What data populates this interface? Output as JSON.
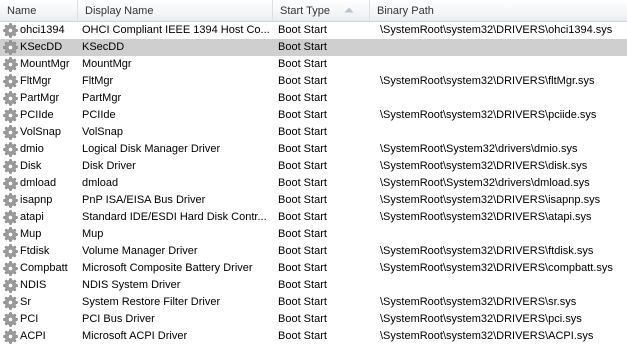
{
  "columns": {
    "name": "Name",
    "display_name": "Display Name",
    "start_type": "Start Type",
    "binary_path": "Binary Path"
  },
  "sort": {
    "column": "start_type",
    "direction": "ascending"
  },
  "icon": "gear-icon",
  "colors": {
    "selected_row": "#cfcfcf",
    "header_border": "#dcdfe3"
  },
  "rows": [
    {
      "name": "ohci1394",
      "display_name": "OHCI Compliant IEEE 1394 Host Co...",
      "start_type": "Boot Start",
      "binary_path": "\\SystemRoot\\system32\\DRIVERS\\ohci1394.sys",
      "selected": false
    },
    {
      "name": "KSecDD",
      "display_name": "KSecDD",
      "start_type": "Boot Start",
      "binary_path": "",
      "selected": true
    },
    {
      "name": "MountMgr",
      "display_name": "MountMgr",
      "start_type": "Boot Start",
      "binary_path": "",
      "selected": false
    },
    {
      "name": "FltMgr",
      "display_name": "FltMgr",
      "start_type": "Boot Start",
      "binary_path": "\\SystemRoot\\system32\\DRIVERS\\fltMgr.sys",
      "selected": false
    },
    {
      "name": "PartMgr",
      "display_name": "PartMgr",
      "start_type": "Boot Start",
      "binary_path": "",
      "selected": false
    },
    {
      "name": "PCIIde",
      "display_name": "PCIIde",
      "start_type": "Boot Start",
      "binary_path": "\\SystemRoot\\system32\\DRIVERS\\pciide.sys",
      "selected": false
    },
    {
      "name": "VolSnap",
      "display_name": "VolSnap",
      "start_type": "Boot Start",
      "binary_path": "",
      "selected": false
    },
    {
      "name": "dmio",
      "display_name": "Logical Disk Manager Driver",
      "start_type": "Boot Start",
      "binary_path": "\\SystemRoot\\System32\\drivers\\dmio.sys",
      "selected": false
    },
    {
      "name": "Disk",
      "display_name": "Disk Driver",
      "start_type": "Boot Start",
      "binary_path": "\\SystemRoot\\system32\\DRIVERS\\disk.sys",
      "selected": false
    },
    {
      "name": "dmload",
      "display_name": "dmload",
      "start_type": "Boot Start",
      "binary_path": "\\SystemRoot\\System32\\drivers\\dmload.sys",
      "selected": false
    },
    {
      "name": "isapnp",
      "display_name": "PnP ISA/EISA Bus Driver",
      "start_type": "Boot Start",
      "binary_path": "\\SystemRoot\\system32\\DRIVERS\\isapnp.sys",
      "selected": false
    },
    {
      "name": "atapi",
      "display_name": "Standard IDE/ESDI Hard Disk Contr...",
      "start_type": "Boot Start",
      "binary_path": "\\SystemRoot\\system32\\DRIVERS\\atapi.sys",
      "selected": false
    },
    {
      "name": "Mup",
      "display_name": "Mup",
      "start_type": "Boot Start",
      "binary_path": "",
      "selected": false
    },
    {
      "name": "Ftdisk",
      "display_name": "Volume Manager Driver",
      "start_type": "Boot Start",
      "binary_path": "\\SystemRoot\\system32\\DRIVERS\\ftdisk.sys",
      "selected": false
    },
    {
      "name": "Compbatt",
      "display_name": "Microsoft Composite Battery Driver",
      "start_type": "Boot Start",
      "binary_path": "\\SystemRoot\\system32\\DRIVERS\\compbatt.sys",
      "selected": false
    },
    {
      "name": "NDIS",
      "display_name": "NDIS System Driver",
      "start_type": "Boot Start",
      "binary_path": "",
      "selected": false
    },
    {
      "name": "Sr",
      "display_name": "System Restore Filter Driver",
      "start_type": "Boot Start",
      "binary_path": "\\SystemRoot\\system32\\DRIVERS\\sr.sys",
      "selected": false
    },
    {
      "name": "PCI",
      "display_name": "PCI Bus Driver",
      "start_type": "Boot Start",
      "binary_path": "\\SystemRoot\\system32\\DRIVERS\\pci.sys",
      "selected": false
    },
    {
      "name": "ACPI",
      "display_name": "Microsoft ACPI Driver",
      "start_type": "Boot Start",
      "binary_path": "\\SystemRoot\\system32\\DRIVERS\\ACPI.sys",
      "selected": false
    }
  ]
}
